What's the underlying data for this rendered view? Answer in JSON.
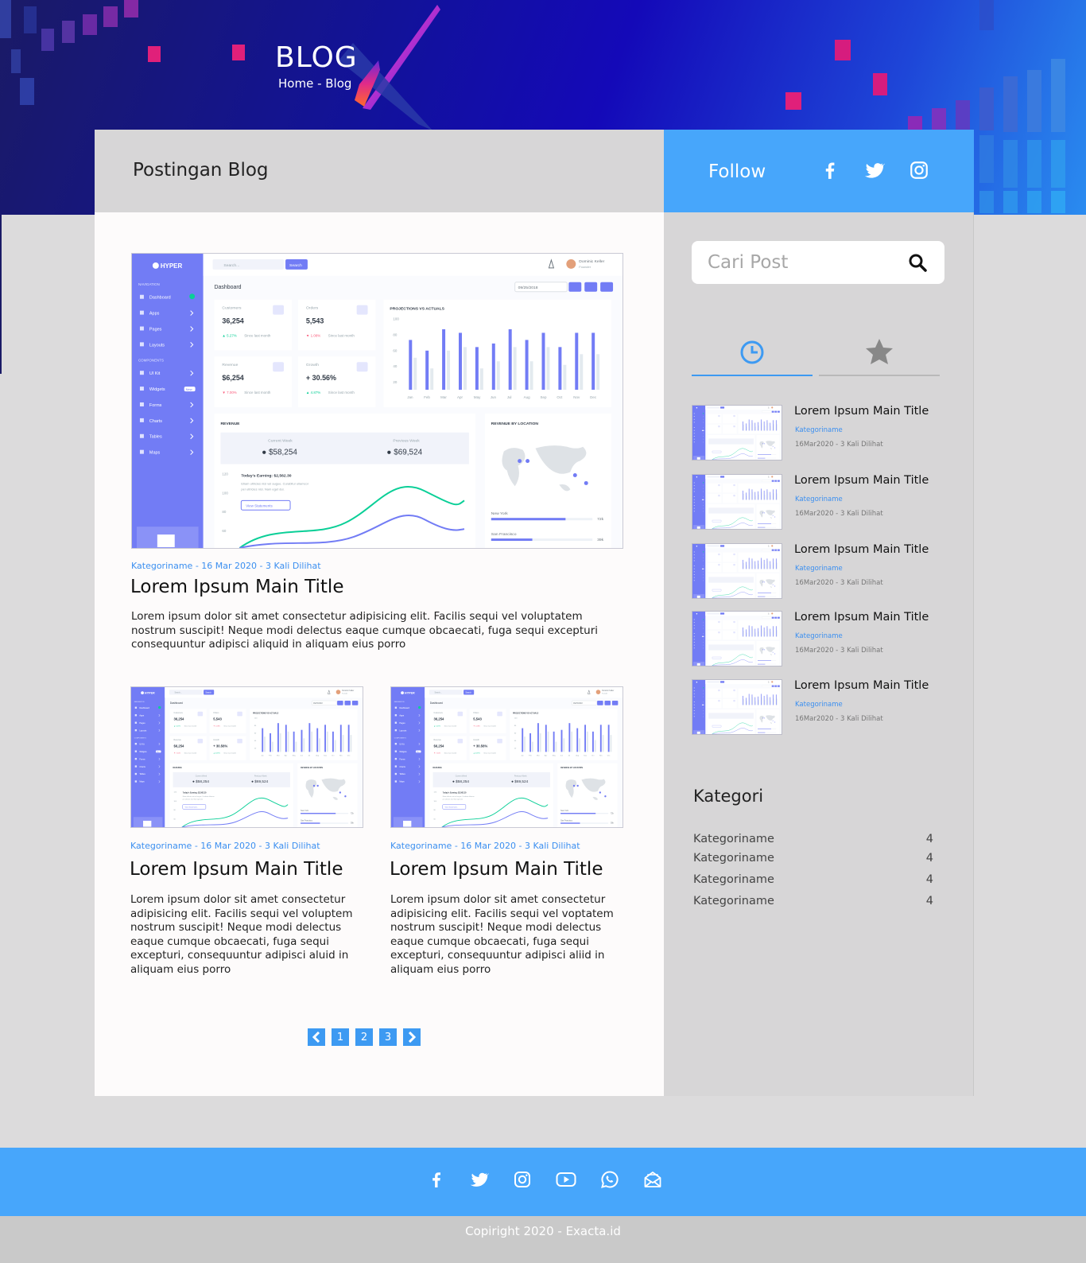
{
  "brand": {
    "logo_text": "BLOG",
    "breadcrumb": "Home - Blog"
  },
  "main": {
    "title": "Postingan Blog",
    "featured": {
      "meta": "Kategoriname - 16 Mar 2020 - 3 Kali Dilihat",
      "title": "Lorem Ipsum Main Title",
      "excerpt": "Lorem ipsum dolor sit amet consectetur adipisicing elit. Facilis sequi vel voluptatem nostrum suscipit! Neque modi delectus eaque cumque obcaecati, fuga sequi excepturi consequuntur adipisci aliquid in aliquam eius porro"
    },
    "posts": [
      {
        "meta": "Kategoriname - 16 Mar 2020 - 3 Kali Dilihat",
        "title": "Lorem Ipsum Main Title",
        "excerpt": "Lorem ipsum dolor sit amet consectetur adipisicing elit. Facilis sequi vel voluptem nostrum suscipit! Neque modi delectus eaque cumque obcaecati, fuga sequi excepturi, consequuntur adipisci aluid in aliquam eius porro"
      },
      {
        "meta": "Kategoriname - 16 Mar 2020 - 3 Kali Dilihat",
        "title": "Lorem Ipsum Main Title",
        "excerpt": "Lorem ipsum dolor sit amet consectetur adipisicing elit. Facilis sequi vel voptatem nostrum suscipit! Neque modi delectus eaque cumque obcaecati, fuga sequi excepturi, consequuntur adipisci aliid in aliquam eius porro"
      }
    ],
    "pagination": {
      "prev_icon": "chevron-left",
      "pages": [
        "1",
        "2",
        "3"
      ],
      "next_icon": "chevron-right"
    },
    "preview": {
      "app": "HYPER",
      "search_placeholder": "Search...",
      "search_button": "Search",
      "user_name": "Dominic Keller",
      "user_role": "Founder",
      "nav_heading": "NAVIGATION",
      "components_heading": "COMPONENTS",
      "nav": [
        "Dashboard",
        "Apps",
        "Pages",
        "Layouts"
      ],
      "components": [
        "UI Kit",
        "Widgets",
        "Forms",
        "Charts",
        "Tables",
        "Maps"
      ],
      "widgets_badge": "New",
      "page_title": "Dashboard",
      "date": "09/25/2018",
      "stats": [
        {
          "label": "Customers",
          "value": "36,254",
          "delta": "5.27%",
          "note": "Since last month",
          "up": true
        },
        {
          "label": "Orders",
          "value": "5,543",
          "delta": "1.08%",
          "note": "Since last month",
          "up": false
        },
        {
          "label": "Revenue",
          "value": "$6,254",
          "delta": "7.00%",
          "note": "Since last month",
          "up": false
        },
        {
          "label": "Growth",
          "value": "+ 30.56%",
          "delta": "4.87%",
          "note": "Since last month",
          "up": true
        }
      ],
      "projections": {
        "title": "PROJECTIONS VS ACTUALS",
        "months": [
          "Jan",
          "Feb",
          "Mar",
          "Apr",
          "May",
          "Jun",
          "Jul",
          "Aug",
          "Sep",
          "Oct",
          "Nov",
          "Dec"
        ],
        "y_ticks": [
          "100",
          "80",
          "60",
          "40",
          "20"
        ]
      },
      "revenue": {
        "title": "REVENUE",
        "current_label": "Current Week",
        "current_value": "$58,254",
        "previous_label": "Previous Week",
        "previous_value": "$69,524",
        "earning": "Today's Earning: $2,562.30",
        "earning_text": "Etiam ultricies nisi vel augue. Curabitur ullamcorper ultricies nisi. Nam eget dui.",
        "button": "View Statements",
        "y_ticks": [
          "120",
          "100",
          "80",
          "60"
        ]
      },
      "location": {
        "title": "REVENUE BY LOCATION",
        "rows": [
          {
            "name": "New York",
            "value": "72k"
          },
          {
            "name": "San Francisco",
            "value": "39k"
          }
        ]
      }
    }
  },
  "sidebar": {
    "follow_label": "Follow",
    "follow_icons": [
      "facebook-icon",
      "twitter-icon",
      "instagram-icon"
    ],
    "search_placeholder": "Cari Post",
    "tabs": [
      "clock-icon",
      "star-icon"
    ],
    "recent": [
      {
        "title": "Lorem Ipsum Main Title",
        "category": "Kategoriname",
        "meta": "16Mar2020 - 3 Kali Dilihat"
      },
      {
        "title": "Lorem Ipsum Main Title",
        "category": "Kategoriname",
        "meta": "16Mar2020 - 3 Kali Dilihat"
      },
      {
        "title": "Lorem Ipsum Main Title",
        "category": "Kategoriname",
        "meta": "16Mar2020 - 3 Kali Dilihat"
      },
      {
        "title": "Lorem Ipsum Main Title",
        "category": "Kategoriname",
        "meta": "16Mar2020 - 3 Kali Dilihat"
      },
      {
        "title": "Lorem Ipsum Main Title",
        "category": "Kategoriname",
        "meta": "16Mar2020 - 3 Kali Dilihat"
      }
    ],
    "kategori_title": "Kategori",
    "kategori": [
      {
        "name": "Kategoriname",
        "count": "4"
      },
      {
        "name": "Kategoriname",
        "count": "4"
      },
      {
        "name": "Kategoriname",
        "count": "4"
      },
      {
        "name": "Kategoriname",
        "count": "4"
      }
    ]
  },
  "footer": {
    "icons": [
      "facebook-icon",
      "twitter-icon",
      "instagram-icon",
      "youtube-icon",
      "whatsapp-icon",
      "email-icon"
    ],
    "copyright": "Copiright 2020 - Exacta.id"
  },
  "colors": {
    "accent": "#47a6fb",
    "link": "#3b8ff0",
    "preview_purple": "#727cf5",
    "preview_green": "#0acf97"
  }
}
